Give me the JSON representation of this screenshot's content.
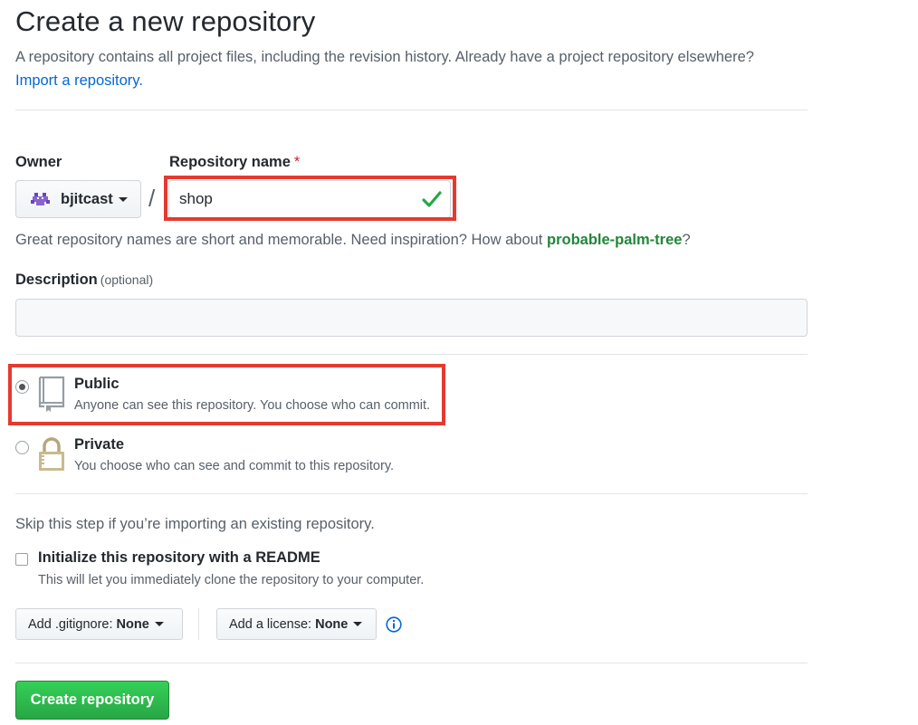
{
  "header": {
    "title": "Create a new repository",
    "subtitle": "A repository contains all project files, including the revision history. Already have a project repository elsewhere?",
    "import_link": "Import a repository."
  },
  "owner": {
    "label": "Owner",
    "value": "bjitcast"
  },
  "repo_name": {
    "label": "Repository name",
    "required_mark": "*",
    "value": "shop",
    "valid": true
  },
  "hint": {
    "text": "Great repository names are short and memorable. Need inspiration? How about",
    "suggestion": "probable-palm-tree",
    "end": "?"
  },
  "description": {
    "label": "Description",
    "optional": "(optional)",
    "value": ""
  },
  "visibility": {
    "selected": "public",
    "options": [
      {
        "id": "public",
        "title": "Public",
        "desc": "Anyone can see this repository. You choose who can commit.",
        "icon": "repo-book-icon"
      },
      {
        "id": "private",
        "title": "Private",
        "desc": "You choose who can see and commit to this repository.",
        "icon": "lock-icon"
      }
    ]
  },
  "init": {
    "skip_text": "Skip this step if you’re importing an existing repository.",
    "readme_title": "Initialize this repository with a README",
    "readme_desc": "This will let you immediately clone the repository to your computer.",
    "readme_checked": false
  },
  "selects": {
    "gitignore_label": "Add .gitignore:",
    "gitignore_value": "None",
    "license_label": "Add a license:",
    "license_value": "None"
  },
  "submit": {
    "label": "Create repository"
  },
  "colors": {
    "highlight": "#e53a2f",
    "primary_button": "#28a745",
    "link": "#0366d6",
    "suggestion": "#22863a"
  }
}
